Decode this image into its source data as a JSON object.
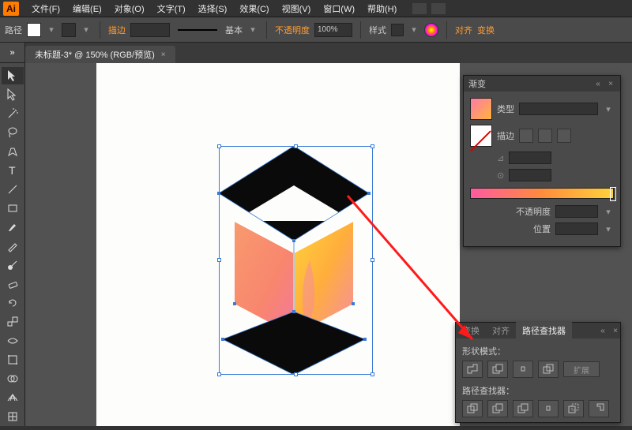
{
  "app": {
    "logo_text": "Ai"
  },
  "menu": {
    "file": "文件(F)",
    "edit": "编辑(E)",
    "object": "对象(O)",
    "type": "文字(T)",
    "select": "选择(S)",
    "effect": "效果(C)",
    "view": "视图(V)",
    "window": "窗口(W)",
    "help": "帮助(H)"
  },
  "control": {
    "path_label": "路径",
    "stroke_label": "描边",
    "stroke_basic": "基本",
    "opacity_label": "不透明度",
    "opacity_value": "100%",
    "style_label": "样式",
    "align_label": "对齐",
    "transform_label": "变换"
  },
  "tab": {
    "title": "未标题-3* @ 150% (RGB/预览)"
  },
  "gradient": {
    "title": "渐变",
    "type_label": "类型",
    "stroke_label": "描边",
    "angle_label": "",
    "ratio_label": "",
    "opacity_label": "不透明度",
    "position_label": "位置"
  },
  "pathfinder": {
    "tab_transform": "变换",
    "tab_align": "对齐",
    "tab_pathfinder": "路径查找器",
    "shape_modes_label": "形状模式：",
    "expand_label": "扩展",
    "pathfinders_label": "路径查找器："
  }
}
